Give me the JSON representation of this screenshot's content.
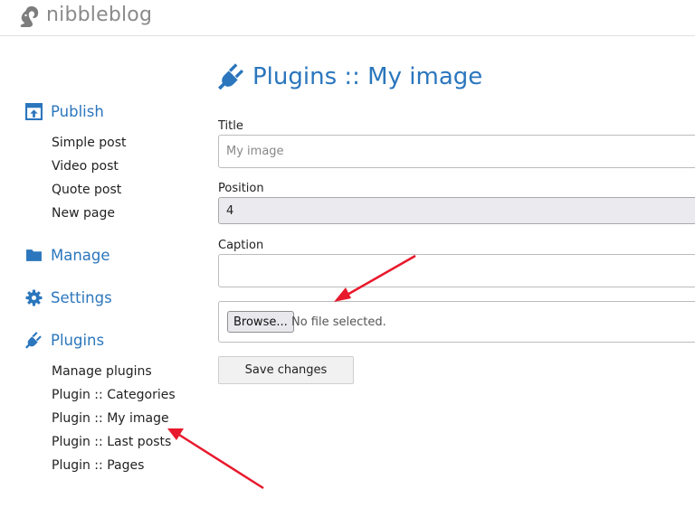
{
  "brand": {
    "name": "nibbleblog",
    "icon": "squirrel-icon"
  },
  "sidebar": {
    "publish": {
      "label": "Publish",
      "icon": "publish-icon",
      "items": [
        "Simple post",
        "Video post",
        "Quote post",
        "New page"
      ]
    },
    "manage": {
      "label": "Manage",
      "icon": "folder-icon"
    },
    "settings": {
      "label": "Settings",
      "icon": "gear-icon"
    },
    "plugins": {
      "label": "Plugins",
      "icon": "plug-icon",
      "items": [
        "Manage plugins",
        "Plugin :: Categories",
        "Plugin :: My image",
        "Plugin :: Last posts",
        "Plugin :: Pages"
      ]
    }
  },
  "main": {
    "title": "Plugins :: My image",
    "title_icon": "plug-icon",
    "form": {
      "title_label": "Title",
      "title_placeholder": "My image",
      "title_value": "",
      "position_label": "Position",
      "position_value": "4",
      "caption_label": "Caption",
      "caption_value": "",
      "browse_label": "Browse...",
      "file_status": "No file selected.",
      "save_label": "Save changes"
    }
  },
  "colors": {
    "accent": "#2b76bd",
    "annotation": "#e8192c"
  }
}
